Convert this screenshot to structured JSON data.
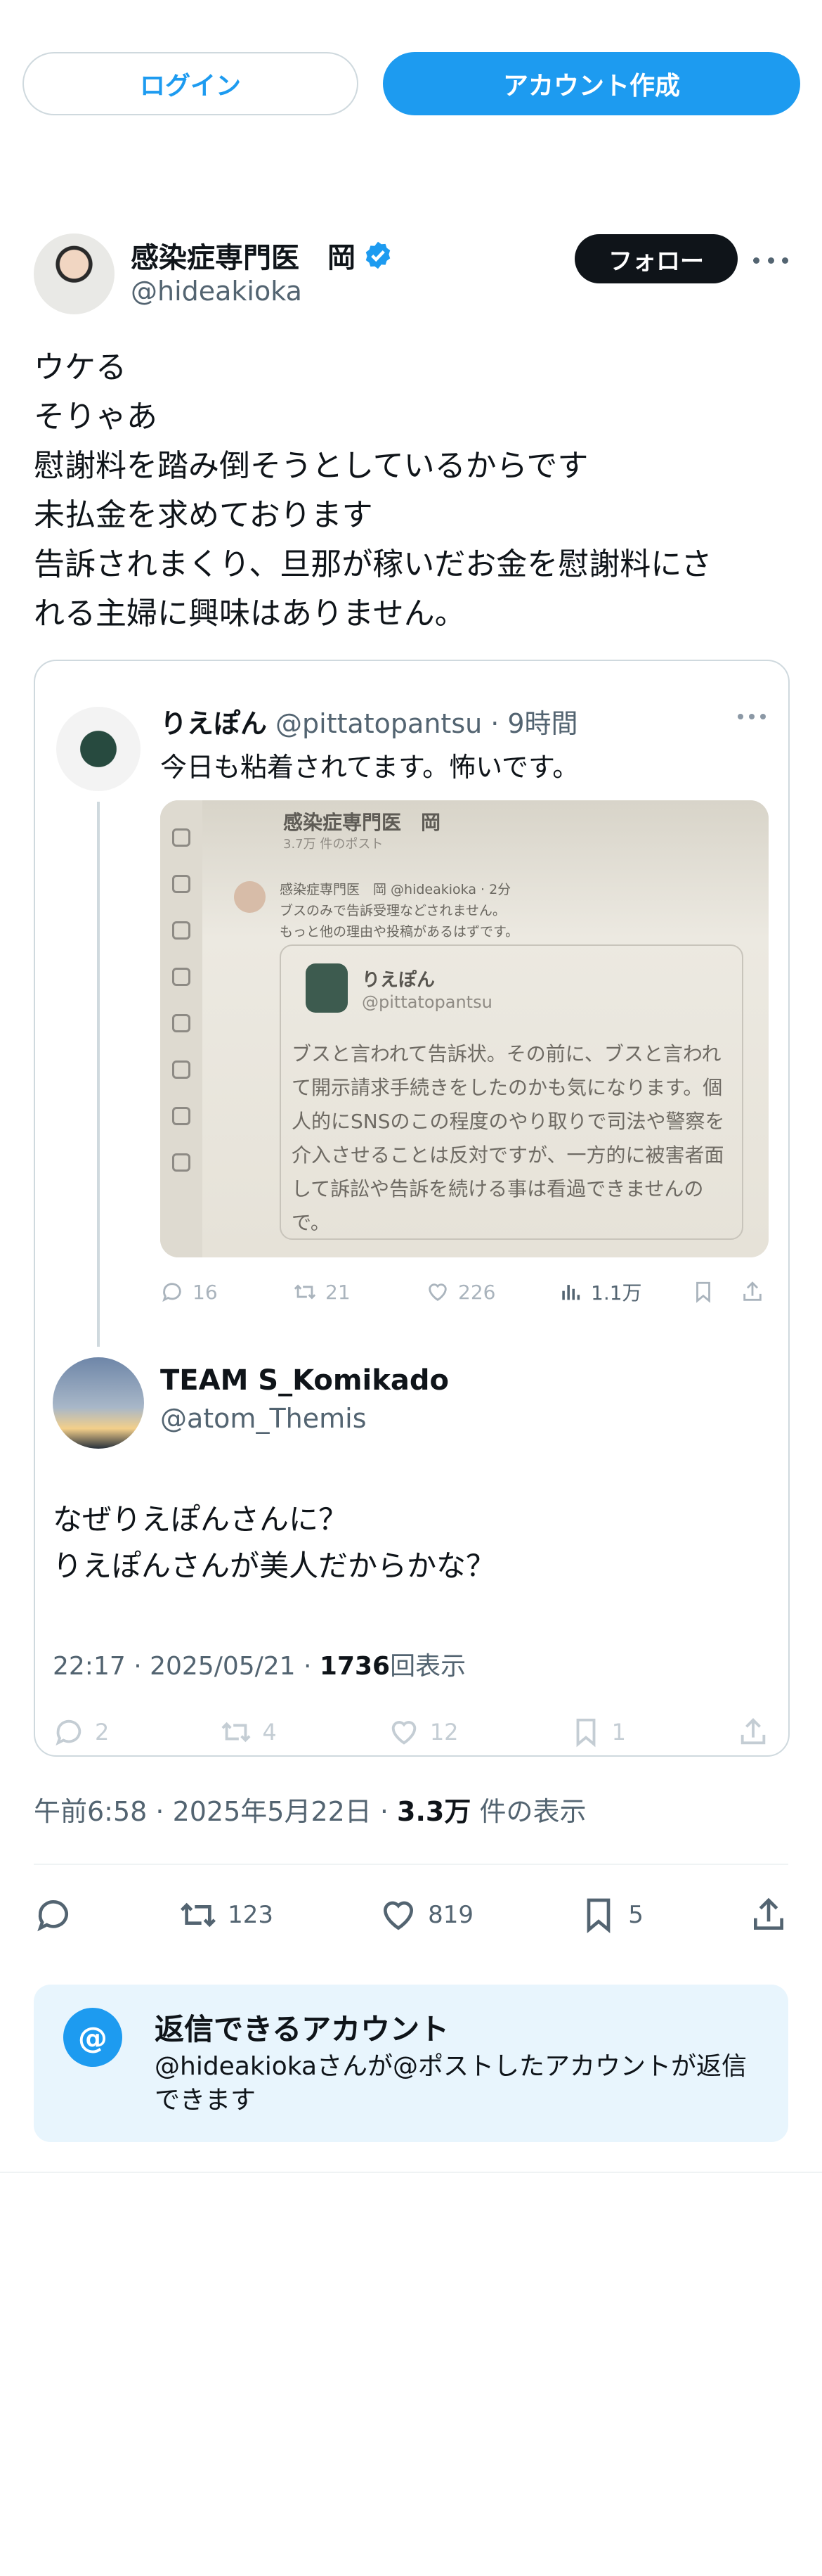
{
  "header": {
    "login_label": "ログイン",
    "create_account_label": "アカウント作成"
  },
  "post": {
    "author_name": "感染症専門医　岡",
    "author_handle": "@hideakioka",
    "follow_label": "フォロー",
    "text": "ウケる\nそりゃあ\n慰謝料を踏み倒そうとしているからです\n未払金を求めております\n告訴されまくり、旦那が稼いだお金を慰謝料にさ\nれる主婦に興味はありません。",
    "time": "午前6:58 · 2025年5月22日 · ",
    "views_count": "3.3万",
    "views_label": " 件の表示",
    "stats": {
      "retweets": "123",
      "likes": "819",
      "bookmarks": "5"
    }
  },
  "quote": {
    "author_name": "りえぽん",
    "author_handle": "@pittatopantsu",
    "time": "· 9時間",
    "text": "今日も粘着されてます。怖いです。",
    "image": {
      "title": "感染症専門医　岡",
      "sub": "3.7万 件のポスト",
      "line1": "感染症専門医　岡 @hideakioka · 2分",
      "line2": "ブスのみで告訴受理などされません。",
      "line3": "もっと他の理由や投稿があるはずです。",
      "inner_name": "りえぽん",
      "inner_handle": "@pittatopantsu",
      "inner_text": "ブスと言われて告訴状。その前に、ブスと言われて開示請求手続きをしたのかも気になります。個人的にSNSのこの程度のやり取りで司法や警察を介入させることは反対ですが、一方的に被害者面して訴訟や告訴を続ける事は看過できませんので。"
    },
    "stats": {
      "replies": "16",
      "retweets": "21",
      "likes": "226",
      "views": "1.1万"
    }
  },
  "quote2": {
    "author_name": "TEAM S_Komikado",
    "author_handle": "@atom_Themis",
    "text": "なぜりえぽんさんに？\nりえぽんさんが美人だからかな？",
    "time": "22:17 · 2025/05/21 · ",
    "views_count": "1736",
    "views_label": "回表示",
    "stats": {
      "replies": "2",
      "retweets": "4",
      "likes": "12",
      "bookmarks": "1"
    }
  },
  "reply_settings": {
    "title": "返信できるアカウント",
    "desc": "@hideakiokaさんが@ポストしたアカウントが返信できます",
    "icon": "@"
  },
  "colors": {
    "accent": "#1d9bf0",
    "text": "#0f1419",
    "muted": "#536471",
    "reply_bg": "#e8f5fd"
  }
}
